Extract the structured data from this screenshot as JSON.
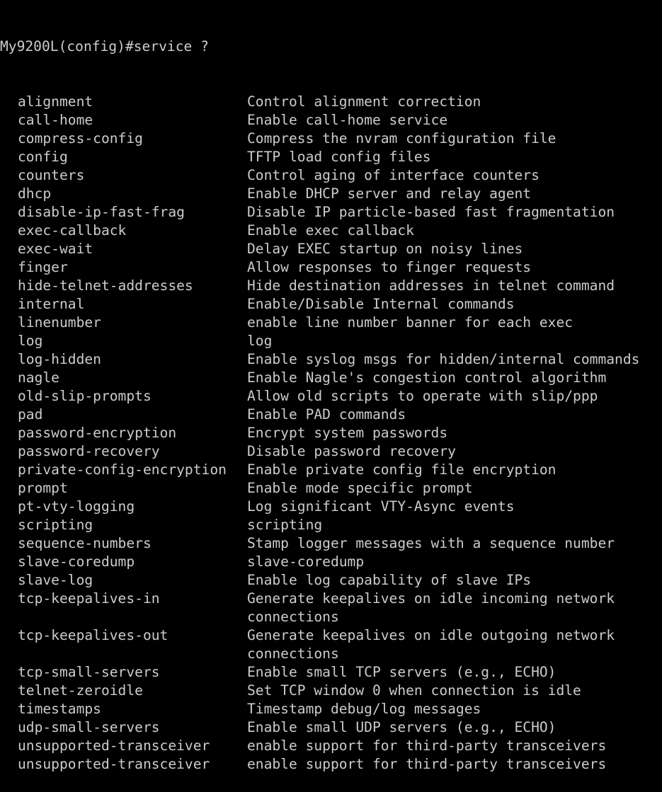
{
  "terminal": {
    "prompt": "My9200L(config)#service ?",
    "colors": {
      "background": "#000000",
      "foreground": "#cccccc"
    },
    "entries": [
      {
        "command": "alignment",
        "description": [
          "Control alignment correction"
        ]
      },
      {
        "command": "call-home",
        "description": [
          "Enable call-home service"
        ]
      },
      {
        "command": "compress-config",
        "description": [
          "Compress the nvram configuration file"
        ]
      },
      {
        "command": "config",
        "description": [
          "TFTP load config files"
        ]
      },
      {
        "command": "counters",
        "description": [
          "Control aging of interface counters"
        ]
      },
      {
        "command": "dhcp",
        "description": [
          "Enable DHCP server and relay agent"
        ]
      },
      {
        "command": "disable-ip-fast-frag",
        "description": [
          "Disable IP particle-based fast fragmentation"
        ]
      },
      {
        "command": "exec-callback",
        "description": [
          "Enable exec callback"
        ]
      },
      {
        "command": "exec-wait",
        "description": [
          "Delay EXEC startup on noisy lines"
        ]
      },
      {
        "command": "finger",
        "description": [
          "Allow responses to finger requests"
        ]
      },
      {
        "command": "hide-telnet-addresses",
        "description": [
          "Hide destination addresses in telnet command"
        ]
      },
      {
        "command": "internal",
        "description": [
          "Enable/Disable Internal commands"
        ]
      },
      {
        "command": "linenumber",
        "description": [
          "enable line number banner for each exec"
        ]
      },
      {
        "command": "log",
        "description": [
          "log"
        ]
      },
      {
        "command": "log-hidden",
        "description": [
          "Enable syslog msgs for hidden/internal commands"
        ]
      },
      {
        "command": "nagle",
        "description": [
          "Enable Nagle's congestion control algorithm"
        ]
      },
      {
        "command": "old-slip-prompts",
        "description": [
          "Allow old scripts to operate with slip/ppp"
        ]
      },
      {
        "command": "pad",
        "description": [
          "Enable PAD commands"
        ]
      },
      {
        "command": "password-encryption",
        "description": [
          "Encrypt system passwords"
        ]
      },
      {
        "command": "password-recovery",
        "description": [
          "Disable password recovery"
        ]
      },
      {
        "command": "private-config-encryption",
        "description": [
          "Enable private config file encryption"
        ]
      },
      {
        "command": "prompt",
        "description": [
          "Enable mode specific prompt"
        ]
      },
      {
        "command": "pt-vty-logging",
        "description": [
          "Log significant VTY-Async events"
        ]
      },
      {
        "command": "scripting",
        "description": [
          "scripting"
        ]
      },
      {
        "command": "sequence-numbers",
        "description": [
          "Stamp logger messages with a sequence number"
        ]
      },
      {
        "command": "slave-coredump",
        "description": [
          "slave-coredump"
        ]
      },
      {
        "command": "slave-log",
        "description": [
          "Enable log capability of slave IPs"
        ]
      },
      {
        "command": "tcp-keepalives-in",
        "description": [
          "Generate keepalives on idle incoming network",
          "connections"
        ]
      },
      {
        "command": "tcp-keepalives-out",
        "description": [
          "Generate keepalives on idle outgoing network",
          "connections"
        ]
      },
      {
        "command": "tcp-small-servers",
        "description": [
          "Enable small TCP servers (e.g., ECHO)"
        ]
      },
      {
        "command": "telnet-zeroidle",
        "description": [
          "Set TCP window 0 when connection is idle"
        ]
      },
      {
        "command": "timestamps",
        "description": [
          "Timestamp debug/log messages"
        ]
      },
      {
        "command": "udp-small-servers",
        "description": [
          "Enable small UDP servers (e.g., ECHO)"
        ]
      },
      {
        "command": "unsupported-transceiver",
        "description": [
          "enable support for third-party transceivers"
        ]
      },
      {
        "command": "unsupported-transceiver",
        "description": [
          "enable support for third-party transceivers"
        ]
      }
    ]
  }
}
